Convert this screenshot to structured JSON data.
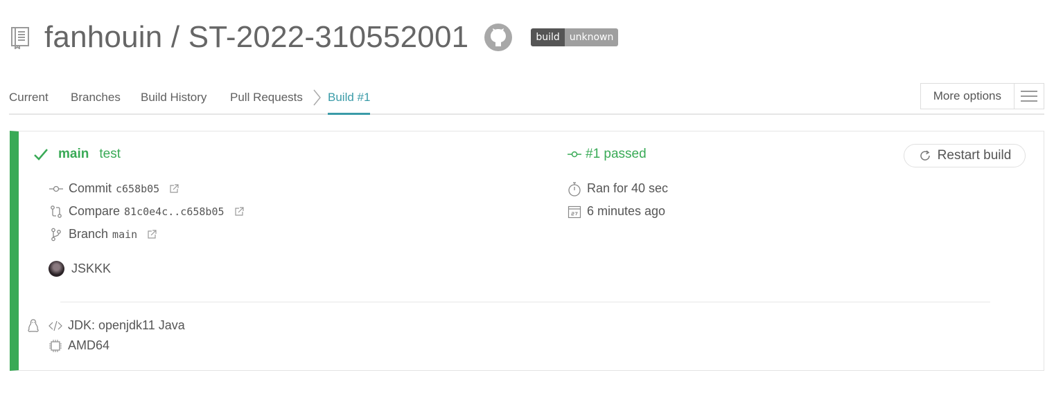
{
  "repo": {
    "title": "fanhouin / ST-2022-310552001",
    "badge_left": "build",
    "badge_right": "unknown"
  },
  "tabs": [
    {
      "label": "Current"
    },
    {
      "label": "Branches"
    },
    {
      "label": "Build History"
    },
    {
      "label": "Pull Requests"
    },
    {
      "label": "Build #1"
    }
  ],
  "more_options": {
    "label": "More options"
  },
  "build": {
    "branch": "main",
    "message": "test",
    "status": "#1 passed",
    "restart_label": "Restart build",
    "commit_label": "Commit",
    "commit_sha": "c658b05",
    "compare_label": "Compare",
    "compare_range": "81c0e4c..c658b05",
    "branch_label": "Branch",
    "branch_value": "main",
    "author": "JSKKK",
    "duration": "Ran for 40 sec",
    "finished": "6 minutes ago",
    "jdk": "JDK: openjdk11 Java",
    "arch": "AMD64"
  },
  "colors": {
    "passed": "#39aa56",
    "accent": "#3a9ba8"
  },
  "icons": [
    "repo-icon",
    "github-icon",
    "check-icon",
    "commit-icon",
    "compare-icon",
    "branch-icon",
    "external-link-icon",
    "stopwatch-icon",
    "calendar-icon",
    "restart-icon",
    "linux-icon",
    "code-icon",
    "cpu-icon",
    "hamburger-icon"
  ]
}
